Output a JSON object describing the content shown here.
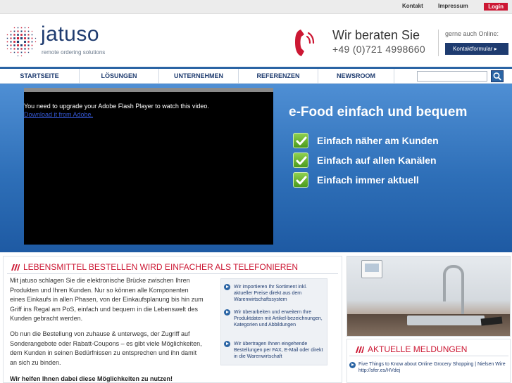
{
  "topbar": {
    "links": [
      "Kontakt",
      "Impressum"
    ],
    "login_label": "Login"
  },
  "brand": {
    "name": "jatuso",
    "tagline": "remote ordering solutions",
    "icon": "jatuso-logo-icon"
  },
  "contact": {
    "title": "Wir beraten Sie",
    "phone": "+49 (0)721 4998660",
    "online_label": "gerne auch Online:",
    "form_button": "Kontaktformular ▸",
    "phone_icon": "phone-icon"
  },
  "nav": {
    "items": [
      "STARTSEITE",
      "LÖSUNGEN",
      "UNTERNEHMEN",
      "REFERENZEN",
      "NEWSROOM"
    ],
    "search_placeholder": "",
    "search_icon": "search-icon"
  },
  "hero": {
    "flash_message": "You need to upgrade your Adobe Flash Player to watch this video.",
    "flash_link": "Download it from Adobe.",
    "title": "e-Food einfach und bequem",
    "benefits": [
      "Einfach näher am Kunden",
      "Einfach auf allen Kanälen",
      "Einfach immer aktuell"
    ],
    "check_icon": "check-icon"
  },
  "main": {
    "heading": "LEBENSMITTEL BESTELLEN WIRD EINFACHER ALS TELEFONIEREN",
    "paragraph1_lines": [
      "Mit jatuso schlagen Sie die elektronische Brücke zwischen Ihren",
      "Produkten und Ihren Kunden. Nur so können alle Komponenten",
      "eines Einkaufs in allen Phasen, von der Einkaufsplanung bis hin zum",
      "Griff ins Regal am PoS, einfach und bequem in die Lebenswelt des",
      "Kunden gebracht werden."
    ],
    "paragraph2_lines": [
      "Ob nun die Bestellung von zuhause & unterwegs, der Zugriff auf",
      "Sonderangebote oder Rabatt-Coupons – es gibt viele Möglichkeiten,",
      "dem Kunden in seinen Bedürfnissen zu entsprechen und ihn damit",
      "an sich zu binden."
    ],
    "closing": "Wir helfen Ihnen dabei diese Möglichkeiten zu nutzen!",
    "info_items": [
      "Wir importieren Ihr Sortiment inkl. aktueller Preise direkt aus dem Warenwirtschaftssystem",
      "Wir überarbeiten und erweitern Ihre Produktdaten mit Artikel-bezeichnungen, Kategorien und Abbildungen",
      "Wir übertragen Ihnen eingehende Bestellungen per FAX, E-Mail oder direkt in die Warenwirtschaft"
    ]
  },
  "news": {
    "heading": "AKTUELLE MELDUNGEN",
    "items": [
      "Five Things to Know about Online Grocery Shopping | Nielsen Wire http://sfer.es/HVdej"
    ]
  },
  "colors": {
    "brand_blue": "#1e3b6f",
    "accent_red": "#cc1733",
    "hero_blue": "#2e6fb8"
  }
}
